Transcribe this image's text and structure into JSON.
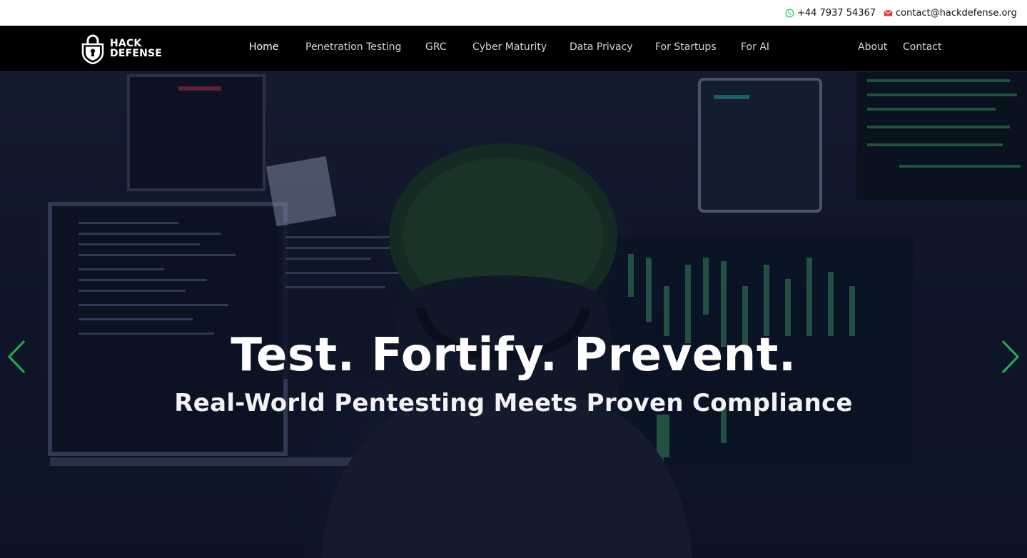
{
  "topbar": {
    "phone": "+44 7937 54367",
    "email": "contact@hackdefense.org",
    "phone_icon": "whatsapp-icon",
    "email_icon": "envelope-icon",
    "phone_icon_color": "#25d366",
    "email_icon_color": "#e53935"
  },
  "logo": {
    "line1": "HACK",
    "line2": "DEFENSE",
    "icon": "padlock-shield-icon"
  },
  "nav": {
    "items": [
      {
        "label": "Home",
        "active": true
      },
      {
        "label": "Penetration Testing"
      },
      {
        "label": "GRC"
      },
      {
        "label": "Cyber Maturity"
      },
      {
        "label": "Data Privacy"
      },
      {
        "label": "For Startups"
      },
      {
        "label": "For AI"
      },
      {
        "label": "About"
      },
      {
        "label": "Contact"
      }
    ]
  },
  "hero": {
    "title": "Test. Fortify. Prevent.",
    "subtitle": "Real-World Pentesting Meets Proven Compliance",
    "prev_icon": "chevron-left-icon",
    "next_icon": "chevron-right-icon",
    "arrow_color": "#22b14c"
  },
  "colors": {
    "navbar_bg": "#000000",
    "hero_overlay": "#0e1628",
    "accent_green": "#22b14c"
  }
}
